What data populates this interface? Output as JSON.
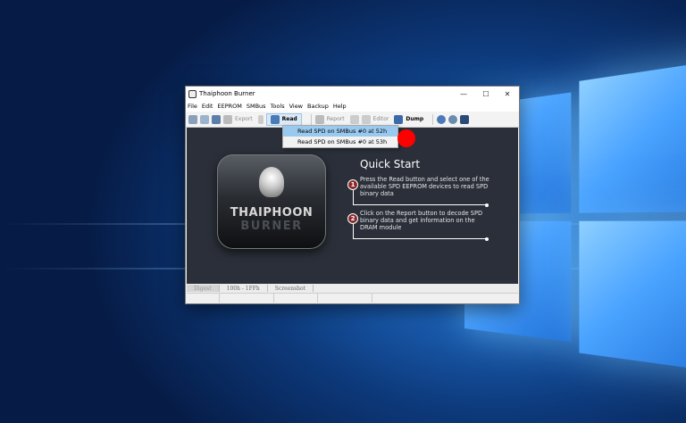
{
  "window": {
    "title": "Thaiphoon Burner"
  },
  "window_controls": {
    "minimize": "—",
    "maximize": "☐",
    "close": "✕"
  },
  "menu": [
    "File",
    "Edit",
    "EEPROM",
    "SMBus",
    "Tools",
    "View",
    "Backup",
    "Help"
  ],
  "toolbar": {
    "export": "Export",
    "read": "Read",
    "report": "Report",
    "editor": "Editor",
    "dump": "Dump"
  },
  "dropdown": {
    "items": [
      "Read SPD on SMBus #0 at 52h",
      "Read SPD on SMBus #0 at 53h"
    ]
  },
  "logo": {
    "line1": "THAIPHOON",
    "line2": "BURNER"
  },
  "quick_start": {
    "title": "Quick Start",
    "steps": [
      {
        "num": "1",
        "text": "Press the Read button and select one of the available SPD EEPROM devices to read SPD binary data"
      },
      {
        "num": "2",
        "text": "Click on the Report button to decode SPD binary data and get information on the DRAM module"
      }
    ]
  },
  "status": {
    "cell1": "Digest",
    "cell2": "100h - 1FFh",
    "cell3": "Screenshot"
  }
}
